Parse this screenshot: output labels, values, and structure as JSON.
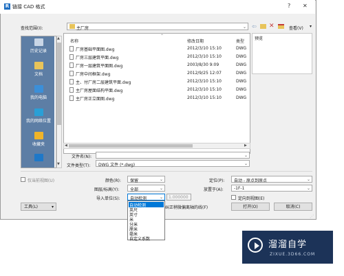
{
  "dialog": {
    "title": "链接 CAD 格式",
    "title_icon": "R",
    "help": "?",
    "close": "✕"
  },
  "toolbar": {
    "lookin_label": "查找范围(I):",
    "lookin_value": "主厂房",
    "view_label": "查看(V)"
  },
  "places": [
    {
      "label": "历史记录",
      "icon": "history-icon"
    },
    {
      "label": "文档",
      "icon": "documents-icon"
    },
    {
      "label": "我的电脑",
      "icon": "computer-icon"
    },
    {
      "label": "我的网络位置",
      "icon": "network-icon"
    },
    {
      "label": "收藏夹",
      "icon": "favorites-icon"
    }
  ],
  "columns": {
    "name": "名称",
    "date": "修改日期",
    "type": "类型"
  },
  "preview_label": "预览",
  "files": [
    {
      "name": "厂房基础平面图.dwg",
      "date": "2012/3/10 15:10",
      "type": "DWG"
    },
    {
      "name": "厂房三层建筑平面.dwg",
      "date": "2012/3/10 15:10",
      "type": "DWG"
    },
    {
      "name": "厂房一层建筑平面图.dwg",
      "date": "2003/8/30 9:09",
      "type": "DWG"
    },
    {
      "name": "厂房中间框架.dwg",
      "date": "2012/9/25 12:07",
      "type": "DWG"
    },
    {
      "name": "主、付厂房二层建筑平面.dwg",
      "date": "2012/3/10 15:10",
      "type": "DWG"
    },
    {
      "name": "主厂房屋面结构平面.dwg",
      "date": "2012/3/10 15:10",
      "type": "DWG"
    },
    {
      "name": "主厂房正立面图.dwg",
      "date": "2012/3/10 15:10",
      "type": "DWG"
    }
  ],
  "filename": {
    "label": "文件名(N):",
    "value": ""
  },
  "filetype": {
    "label": "文件类型(T):",
    "value": "DWG 文件 (*.dwg)"
  },
  "options": {
    "current_view_only": "仅当前视图(U)",
    "colors_label": "颜色(R):",
    "colors_value": "保留",
    "layers_label": "图层/标高(Y):",
    "layers_value": "全部",
    "units_label": "导入单位(S):",
    "units_value": "自动检测",
    "scale_value": "1.000000",
    "position_label": "定位(P):",
    "position_value": "自动 - 原点到原点",
    "place_at_label": "放置于(A):",
    "place_at_value": "-1F-1",
    "orient_label": "定向到视图(E)",
    "correct_label": "纠正稍微偏离轴的线(F)"
  },
  "units_options": [
    "自动检测",
    "英尺",
    "英寸",
    "米",
    "分米",
    "厘米",
    "毫米",
    "自定义系数"
  ],
  "buttons": {
    "tools": "工具(L)",
    "open": "打开(O)",
    "cancel": "取消(C)"
  },
  "watermark": {
    "main": "溜溜自学",
    "sub": "ZIXUE.3D66.COM"
  }
}
